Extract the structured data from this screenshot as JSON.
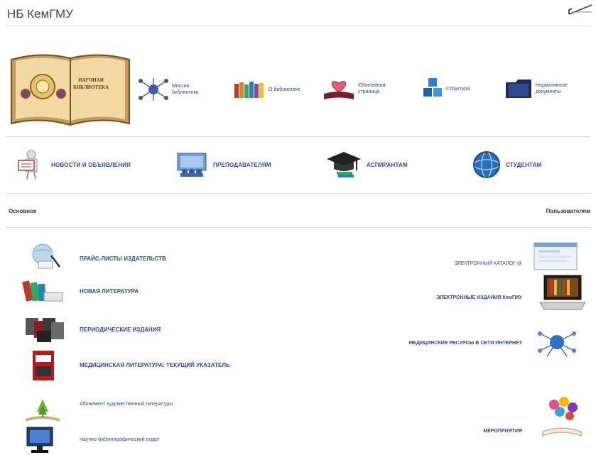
{
  "header": {
    "title": "НБ КемГМУ"
  },
  "book": {
    "title_line1": "НАУЧНАЯ",
    "title_line2": "БИБЛИОТЕКА"
  },
  "top_nav": [
    {
      "label": "Миссия библиотеки"
    },
    {
      "label": "О библиотеке"
    },
    {
      "label": "Юбилейная страница"
    },
    {
      "label": "Структура"
    },
    {
      "label": "Нормативные документы"
    }
  ],
  "audience": [
    {
      "label": "НОВОСТИ И ОБЪЯВЛЕНИЯ"
    },
    {
      "label": "ПРЕПОДАВАТЕЛЯМ"
    },
    {
      "label": "АСПИРАНТАМ"
    },
    {
      "label": "СТУДЕНТАМ"
    }
  ],
  "sections": {
    "left": "Основное",
    "right": "Пользователям"
  },
  "left_links": [
    {
      "label": "ПРАЙС-ЛИСТЫ ИЗДАТЕЛЬСТВ"
    },
    {
      "label": "НОВАЯ ЛИТЕРАТУРА"
    },
    {
      "label": "ПЕРИОДИЧЕСКИЕ ИЗДАНИЯ"
    },
    {
      "label": "МЕДИЦИНСКАЯ ЛИТЕРАТУРА: ТЕКУЩИЙ УКАЗАТЕЛЬ"
    },
    {
      "label": "Абонемент художественной литературы"
    },
    {
      "label": "Научно-библиографический отдел"
    }
  ],
  "right_links": [
    {
      "label": "ЭЛЕКТРОННЫЙ КАТАЛОГ @"
    },
    {
      "label": "ЭЛЕКТРОННЫЕ ИЗДАНИЯ КемГМУ"
    },
    {
      "label": "МЕДИЦИНСКИЕ РЕСУРСЫ В СЕТИ ИНТЕРНЕТ"
    },
    {
      "label": "МЕРОПРИЯТИЯ"
    }
  ]
}
